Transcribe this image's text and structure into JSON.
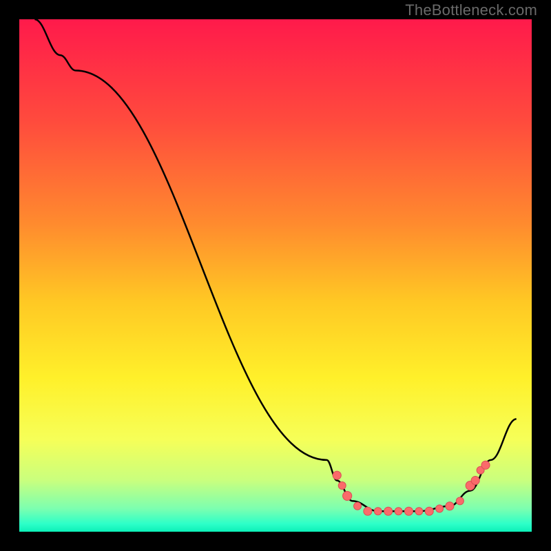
{
  "attribution": "TheBottleneck.com",
  "colors": {
    "stops": [
      {
        "offset": 0.0,
        "color": "#ff1a4b"
      },
      {
        "offset": 0.2,
        "color": "#ff4b3d"
      },
      {
        "offset": 0.4,
        "color": "#ff8b2e"
      },
      {
        "offset": 0.55,
        "color": "#ffc824"
      },
      {
        "offset": 0.7,
        "color": "#fff02a"
      },
      {
        "offset": 0.82,
        "color": "#f6ff58"
      },
      {
        "offset": 0.9,
        "color": "#c9ff7e"
      },
      {
        "offset": 0.955,
        "color": "#7cffb0"
      },
      {
        "offset": 0.985,
        "color": "#2cffc8"
      },
      {
        "offset": 1.0,
        "color": "#0cf0b8"
      }
    ],
    "dot_fill": "#fa6a6a",
    "dot_stroke": "#d94f55",
    "curve": "#000000",
    "frame": "#000000"
  },
  "chart_data": {
    "type": "line",
    "title": "",
    "xlabel": "",
    "ylabel": "",
    "xlim": [
      0,
      100
    ],
    "ylim": [
      0,
      100
    ],
    "curve": [
      {
        "x": 3,
        "y": 100
      },
      {
        "x": 8,
        "y": 93
      },
      {
        "x": 11,
        "y": 90
      },
      {
        "x": 60,
        "y": 14
      },
      {
        "x": 62,
        "y": 10
      },
      {
        "x": 65,
        "y": 6
      },
      {
        "x": 70,
        "y": 4
      },
      {
        "x": 78,
        "y": 4
      },
      {
        "x": 84,
        "y": 5
      },
      {
        "x": 88,
        "y": 8
      },
      {
        "x": 92,
        "y": 14
      },
      {
        "x": 97,
        "y": 22
      }
    ],
    "dots": [
      {
        "x": 62,
        "y": 11,
        "r": 1.1
      },
      {
        "x": 63,
        "y": 9,
        "r": 1.0
      },
      {
        "x": 64,
        "y": 7,
        "r": 1.2
      },
      {
        "x": 66,
        "y": 5,
        "r": 1.0
      },
      {
        "x": 68,
        "y": 4,
        "r": 1.1
      },
      {
        "x": 70,
        "y": 4,
        "r": 1.0
      },
      {
        "x": 72,
        "y": 4,
        "r": 1.1
      },
      {
        "x": 74,
        "y": 4,
        "r": 1.0
      },
      {
        "x": 76,
        "y": 4,
        "r": 1.1
      },
      {
        "x": 78,
        "y": 4,
        "r": 1.0
      },
      {
        "x": 80,
        "y": 4,
        "r": 1.1
      },
      {
        "x": 82,
        "y": 4.5,
        "r": 1.0
      },
      {
        "x": 84,
        "y": 5,
        "r": 1.1
      },
      {
        "x": 86,
        "y": 6,
        "r": 1.0
      },
      {
        "x": 88,
        "y": 9,
        "r": 1.2
      },
      {
        "x": 89,
        "y": 10,
        "r": 1.1
      },
      {
        "x": 90,
        "y": 12,
        "r": 1.0
      },
      {
        "x": 91,
        "y": 13,
        "r": 1.1
      }
    ]
  }
}
